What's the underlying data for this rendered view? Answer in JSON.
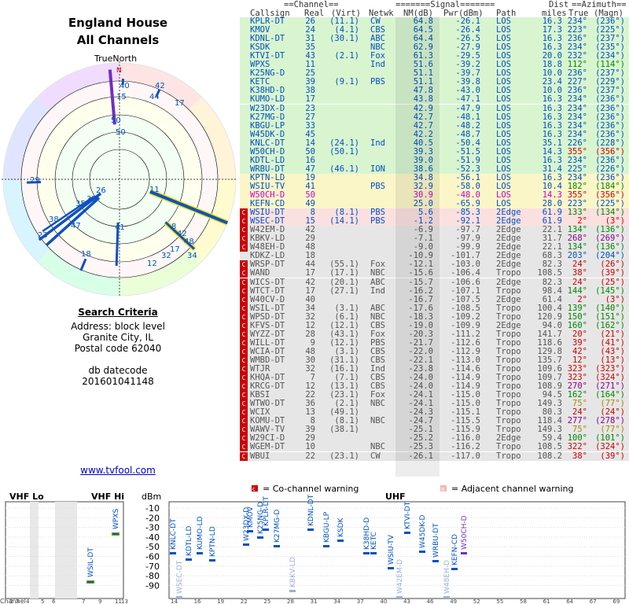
{
  "header": {
    "title": "England House",
    "subtitle": "All Channels",
    "north_label": "TrueNorth",
    "north_mark": "N"
  },
  "search": {
    "heading": "Search Criteria",
    "address": "Address: block level",
    "city": "Granite City, IL",
    "postal": "Postal code 62040",
    "db_label": "db datecode",
    "db_value": "201601041148"
  },
  "footer_link": "www.tvfool.com",
  "table_headers": {
    "group_channel": "==Channel==",
    "group_signal": "=======Signal=======",
    "group_dist": "Dist",
    "group_azimuth": "==Azimuth==",
    "callsign": "Callsign",
    "real": "Real",
    "virt": "(Virt)",
    "netwk": "Netwk",
    "nm": "NM(dB)",
    "pwr": "Pwr(dBm)",
    "path": "Path",
    "miles": "miles",
    "true": "True",
    "magn": "(Magn)"
  },
  "stations": [
    {
      "call": "KPLR-DT",
      "real": "26",
      "virt": "(11.1)",
      "net": "CW",
      "nm": "64.8",
      "pwr": "-26.1",
      "path": "LOS",
      "dist": "16.3",
      "az": "234°",
      "mag": "(236°)",
      "band": "g",
      "w": ""
    },
    {
      "call": "KMOV",
      "real": "24",
      "virt": "(4.1)",
      "net": "CBS",
      "nm": "64.5",
      "pwr": "-26.4",
      "path": "LOS",
      "dist": "17.3",
      "az": "223°",
      "mag": "(225°)",
      "band": "g",
      "w": ""
    },
    {
      "call": "KDNL-DT",
      "real": "31",
      "virt": "(30.1)",
      "net": "ABC",
      "nm": "64.4",
      "pwr": "-26.5",
      "path": "LOS",
      "dist": "16.3",
      "az": "236°",
      "mag": "(237°)",
      "band": "g",
      "w": ""
    },
    {
      "call": "KSDK",
      "real": "35",
      "virt": "",
      "net": "NBC",
      "nm": "62.9",
      "pwr": "-27.9",
      "path": "LOS",
      "dist": "16.3",
      "az": "234°",
      "mag": "(235°)",
      "band": "g",
      "w": ""
    },
    {
      "call": "KTVI-DT",
      "real": "43",
      "virt": "(2.1)",
      "net": "Fox",
      "nm": "61.3",
      "pwr": "-29.5",
      "path": "LOS",
      "dist": "20.0",
      "az": "232°",
      "mag": "(234°)",
      "band": "g",
      "w": ""
    },
    {
      "call": "WPXS",
      "real": "11",
      "virt": "",
      "net": "Ind",
      "nm": "51.6",
      "pwr": "-39.2",
      "path": "LOS",
      "dist": "18.8",
      "az": "112°",
      "mag": "(114°)",
      "band": "g",
      "w": ""
    },
    {
      "call": "K25NG-D",
      "real": "25",
      "virt": "",
      "net": "",
      "nm": "51.1",
      "pwr": "-39.7",
      "path": "LOS",
      "dist": "10.0",
      "az": "236°",
      "mag": "(237°)",
      "band": "g",
      "w": ""
    },
    {
      "call": "KETC",
      "real": "39",
      "virt": "(9.1)",
      "net": "PBS",
      "nm": "51.1",
      "pwr": "-39.8",
      "path": "LOS",
      "dist": "23.4",
      "az": "227°",
      "mag": "(229°)",
      "band": "g",
      "w": ""
    },
    {
      "call": "K38HD-D",
      "real": "38",
      "virt": "",
      "net": "",
      "nm": "47.8",
      "pwr": "-43.0",
      "path": "LOS",
      "dist": "10.0",
      "az": "236°",
      "mag": "(237°)",
      "band": "g",
      "w": ""
    },
    {
      "call": "KUMO-LD",
      "real": "17",
      "virt": "",
      "net": "",
      "nm": "43.8",
      "pwr": "-47.1",
      "path": "LOS",
      "dist": "16.3",
      "az": "234°",
      "mag": "(236°)",
      "band": "g",
      "w": ""
    },
    {
      "call": "W23DX-D",
      "real": "23",
      "virt": "",
      "net": "",
      "nm": "42.9",
      "pwr": "-47.9",
      "path": "LOS",
      "dist": "16.3",
      "az": "234°",
      "mag": "(236°)",
      "band": "g",
      "w": ""
    },
    {
      "call": "K27MG-D",
      "real": "27",
      "virt": "",
      "net": "",
      "nm": "42.7",
      "pwr": "-48.1",
      "path": "LOS",
      "dist": "16.3",
      "az": "234°",
      "mag": "(236°)",
      "band": "g",
      "w": ""
    },
    {
      "call": "KBGU-LP",
      "real": "33",
      "virt": "",
      "net": "",
      "nm": "42.7",
      "pwr": "-48.2",
      "path": "LOS",
      "dist": "16.3",
      "az": "234°",
      "mag": "(236°)",
      "band": "g",
      "w": ""
    },
    {
      "call": "W45DK-D",
      "real": "45",
      "virt": "",
      "net": "",
      "nm": "42.2",
      "pwr": "-48.7",
      "path": "LOS",
      "dist": "16.3",
      "az": "234°",
      "mag": "(236°)",
      "band": "g",
      "w": ""
    },
    {
      "call": "KNLC-DT",
      "real": "14",
      "virt": "(24.1)",
      "net": "Ind",
      "nm": "40.5",
      "pwr": "-50.4",
      "path": "LOS",
      "dist": "35.1",
      "az": "226°",
      "mag": "(228°)",
      "band": "g",
      "w": ""
    },
    {
      "call": "W50CH-D",
      "real": "50",
      "virt": "(50.1)",
      "net": "",
      "nm": "39.3",
      "pwr": "-51.5",
      "path": "LOS",
      "dist": "14.3",
      "az": "355°",
      "mag": "(356°)",
      "band": "g",
      "w": ""
    },
    {
      "call": "KDTL-LD",
      "real": "16",
      "virt": "",
      "net": "",
      "nm": "39.0",
      "pwr": "-51.9",
      "path": "LOS",
      "dist": "16.3",
      "az": "234°",
      "mag": "(236°)",
      "band": "g",
      "w": ""
    },
    {
      "call": "WRBU-DT",
      "real": "47",
      "virt": "(46.1)",
      "net": "ION",
      "nm": "38.6",
      "pwr": "-52.3",
      "path": "LOS",
      "dist": "31.4",
      "az": "225°",
      "mag": "(226°)",
      "band": "g",
      "w": ""
    },
    {
      "call": "KPTN-LD",
      "real": "19",
      "virt": "",
      "net": "",
      "nm": "34.8",
      "pwr": "-56.1",
      "path": "LOS",
      "dist": "16.3",
      "az": "234°",
      "mag": "(236°)",
      "band": "y",
      "w": ""
    },
    {
      "call": "WSIU-TV",
      "real": "41",
      "virt": "",
      "net": "PBS",
      "nm": "32.9",
      "pwr": "-58.0",
      "path": "LOS",
      "dist": "10.4",
      "az": "182°",
      "mag": "(184°)",
      "band": "y",
      "w": ""
    },
    {
      "call": "W50CH-D",
      "real": "50",
      "virt": "",
      "net": "",
      "nm": "30.9",
      "pwr": "-48.0",
      "path": "LOS",
      "dist": "14.3",
      "az": "355°",
      "mag": "(356°)",
      "band": "p",
      "w": ""
    },
    {
      "call": "KEFN-CD",
      "real": "49",
      "virt": "",
      "net": "",
      "nm": "25.0",
      "pwr": "-65.9",
      "path": "LOS",
      "dist": "28.0",
      "az": "223°",
      "mag": "(225°)",
      "band": "y",
      "w": ""
    },
    {
      "call": "WSIU-DT",
      "real": "8",
      "virt": "(8.1)",
      "net": "PBS",
      "nm": "5.6",
      "pwr": "-85.3",
      "path": "2Edge",
      "dist": "61.9",
      "az": "133°",
      "mag": "(134°)",
      "band": "r",
      "w": "C"
    },
    {
      "call": "WSEC-DT",
      "real": "15",
      "virt": "(14.1)",
      "net": "PBS",
      "nm": "-1.2",
      "pwr": "-92.1",
      "path": "2Edge",
      "dist": "61.9",
      "az": "2°",
      "mag": "(3°)",
      "band": "r",
      "w": "C"
    },
    {
      "call": "W42EM-D",
      "real": "42",
      "virt": "",
      "net": "",
      "nm": "-6.9",
      "pwr": "-97.7",
      "path": "2Edge",
      "dist": "22.1",
      "az": "134°",
      "mag": "(136°)",
      "band": "x",
      "w": "C"
    },
    {
      "call": "KBKV-LD",
      "real": "29",
      "virt": "",
      "net": "",
      "nm": "-7.1",
      "pwr": "-97.9",
      "path": "2Edge",
      "dist": "31.7",
      "az": "268°",
      "mag": "(269°)",
      "band": "x",
      "w": "C"
    },
    {
      "call": "W48EH-D",
      "real": "48",
      "virt": "",
      "net": "",
      "nm": "-9.0",
      "pwr": "-99.9",
      "path": "2Edge",
      "dist": "22.1",
      "az": "134°",
      "mag": "(136°)",
      "band": "x",
      "w": "C"
    },
    {
      "call": "KDKZ-LD",
      "real": "18",
      "virt": "",
      "net": "",
      "nm": "-10.9",
      "pwr": "-101.7",
      "path": "2Edge",
      "dist": "68.3",
      "az": "203°",
      "mag": "(204°)",
      "band": "x",
      "w": ""
    },
    {
      "call": "WRSP-DT",
      "real": "44",
      "virt": "(55.1)",
      "net": "Fox",
      "nm": "-12.1",
      "pwr": "-103.0",
      "path": "2Edge",
      "dist": "82.3",
      "az": "24°",
      "mag": "(26°)",
      "band": "x",
      "w": "C"
    },
    {
      "call": "WAND",
      "real": "17",
      "virt": "(17.1)",
      "net": "NBC",
      "nm": "-15.6",
      "pwr": "-106.4",
      "path": "Tropo",
      "dist": "108.5",
      "az": "38°",
      "mag": "(39°)",
      "band": "x",
      "w": "C"
    },
    {
      "call": "WICS-DT",
      "real": "42",
      "virt": "(20.1)",
      "net": "ABC",
      "nm": "-15.7",
      "pwr": "-106.6",
      "path": "2Edge",
      "dist": "82.3",
      "az": "24°",
      "mag": "(25°)",
      "band": "x",
      "w": "C"
    },
    {
      "call": "WTCT-DT",
      "real": "17",
      "virt": "(27.1)",
      "net": "Ind",
      "nm": "-16.2",
      "pwr": "-107.1",
      "path": "Tropo",
      "dist": "98.4",
      "az": "144°",
      "mag": "(145°)",
      "band": "x",
      "w": "C"
    },
    {
      "call": "W40CV-D",
      "real": "40",
      "virt": "",
      "net": "",
      "nm": "-16.7",
      "pwr": "-107.5",
      "path": "2Edge",
      "dist": "61.4",
      "az": "2°",
      "mag": "(3°)",
      "band": "x",
      "w": "C"
    },
    {
      "call": "WSIL-DT",
      "real": "34",
      "virt": "(3.1)",
      "net": "ABC",
      "nm": "-17.6",
      "pwr": "-108.5",
      "path": "Tropo",
      "dist": "100.4",
      "az": "139°",
      "mag": "(140°)",
      "band": "x",
      "w": "C"
    },
    {
      "call": "WPSD-DT",
      "real": "32",
      "virt": "(6.1)",
      "net": "NBC",
      "nm": "-18.3",
      "pwr": "-109.2",
      "path": "Tropo",
      "dist": "120.9",
      "az": "150°",
      "mag": "(151°)",
      "band": "x",
      "w": "C"
    },
    {
      "call": "KFVS-DT",
      "real": "12",
      "virt": "(12.1)",
      "net": "CBS",
      "nm": "-19.0",
      "pwr": "-109.9",
      "path": "2Edge",
      "dist": "94.0",
      "az": "160°",
      "mag": "(162°)",
      "band": "x",
      "w": "C"
    },
    {
      "call": "WYZZ-DT",
      "real": "28",
      "virt": "(43.1)",
      "net": "Fox",
      "nm": "-20.3",
      "pwr": "-111.2",
      "path": "Tropo",
      "dist": "141.7",
      "az": "20°",
      "mag": "(21°)",
      "band": "x",
      "w": "C"
    },
    {
      "call": "WILL-DT",
      "real": "9",
      "virt": "(12.1)",
      "net": "PBS",
      "nm": "-21.7",
      "pwr": "-112.6",
      "path": "Tropo",
      "dist": "118.6",
      "az": "39°",
      "mag": "(41°)",
      "band": "x",
      "w": "C"
    },
    {
      "call": "WCIA-DT",
      "real": "48",
      "virt": "(3.1)",
      "net": "CBS",
      "nm": "-22.0",
      "pwr": "-112.9",
      "path": "Tropo",
      "dist": "129.8",
      "az": "42°",
      "mag": "(43°)",
      "band": "x",
      "w": "C"
    },
    {
      "call": "WMBD-DT",
      "real": "30",
      "virt": "(31.1)",
      "net": "CBS",
      "nm": "-22.1",
      "pwr": "-113.0",
      "path": "Tropo",
      "dist": "135.7",
      "az": "12°",
      "mag": "(13°)",
      "band": "x",
      "w": "C"
    },
    {
      "call": "WTJR",
      "real": "32",
      "virt": "(16.1)",
      "net": "Ind",
      "nm": "-23.8",
      "pwr": "-114.6",
      "path": "Tropo",
      "dist": "109.6",
      "az": "323°",
      "mag": "(323°)",
      "band": "x",
      "w": "C"
    },
    {
      "call": "KHQA-DT",
      "real": "7",
      "virt": "(7.1)",
      "net": "CBS",
      "nm": "-24.0",
      "pwr": "-114.9",
      "path": "Tropo",
      "dist": "109.7",
      "az": "323°",
      "mag": "(324°)",
      "band": "x",
      "w": "C"
    },
    {
      "call": "KRCG-DT",
      "real": "12",
      "virt": "(13.1)",
      "net": "CBS",
      "nm": "-24.0",
      "pwr": "-114.9",
      "path": "Tropo",
      "dist": "108.9",
      "az": "270°",
      "mag": "(271°)",
      "band": "x",
      "w": "C"
    },
    {
      "call": "KBSI",
      "real": "22",
      "virt": "(23.1)",
      "net": "Fox",
      "nm": "-24.1",
      "pwr": "-115.0",
      "path": "Tropo",
      "dist": "94.5",
      "az": "162°",
      "mag": "(164°)",
      "band": "x",
      "w": "C"
    },
    {
      "call": "WTWO-DT",
      "real": "36",
      "virt": "(2.1)",
      "net": "NBC",
      "nm": "-24.1",
      "pwr": "-115.0",
      "path": "Tropo",
      "dist": "149.3",
      "az": "75°",
      "mag": "(77°)",
      "band": "x",
      "w": "C"
    },
    {
      "call": "WCIX",
      "real": "13",
      "virt": "(49.1)",
      "net": "",
      "nm": "-24.3",
      "pwr": "-115.1",
      "path": "Tropo",
      "dist": "80.3",
      "az": "24°",
      "mag": "(24°)",
      "band": "x",
      "w": "C"
    },
    {
      "call": "KOMU-DT",
      "real": "8",
      "virt": "(8.1)",
      "net": "NBC",
      "nm": "-24.7",
      "pwr": "-115.5",
      "path": "Tropo",
      "dist": "118.4",
      "az": "277°",
      "mag": "(278°)",
      "band": "x",
      "w": "C"
    },
    {
      "call": "WAWV-TV",
      "real": "39",
      "virt": "(38.1)",
      "net": "",
      "nm": "-25.1",
      "pwr": "-115.9",
      "path": "Tropo",
      "dist": "149.3",
      "az": "75°",
      "mag": "(77°)",
      "band": "x",
      "w": "C"
    },
    {
      "call": "W29CI-D",
      "real": "29",
      "virt": "",
      "net": "",
      "nm": "-25.2",
      "pwr": "-116.0",
      "path": "2Edge",
      "dist": "59.4",
      "az": "100°",
      "mag": "(101°)",
      "band": "x",
      "w": "C"
    },
    {
      "call": "WGEM-DT",
      "real": "10",
      "virt": "",
      "net": "NBC",
      "nm": "-25.3",
      "pwr": "-116.2",
      "path": "Tropo",
      "dist": "108.5",
      "az": "322°",
      "mag": "(324°)",
      "band": "x",
      "w": "C"
    },
    {
      "call": "WBUI",
      "real": "22",
      "virt": "(23.1)",
      "net": "CW",
      "nm": "-26.1",
      "pwr": "-117.0",
      "path": "Tropo",
      "dist": "108.2",
      "az": "38°",
      "mag": "(39°)",
      "band": "x",
      "w": "C"
    }
  ],
  "polar_labels": [
    {
      "t": "40"
    },
    {
      "t": "15"
    },
    {
      "t": "42"
    },
    {
      "t": "44"
    },
    {
      "t": "17"
    },
    {
      "t": "50"
    },
    {
      "t": "50"
    },
    {
      "t": "29"
    },
    {
      "t": "11"
    },
    {
      "t": "26"
    },
    {
      "t": "41"
    },
    {
      "t": "8"
    },
    {
      "t": "42"
    },
    {
      "t": "48"
    },
    {
      "t": "18"
    },
    {
      "t": "17"
    },
    {
      "t": "32"
    },
    {
      "t": "34"
    },
    {
      "t": "12"
    },
    {
      "t": "23"
    },
    {
      "t": "38"
    },
    {
      "t": "35"
    },
    {
      "t": "33"
    },
    {
      "t": "47"
    }
  ],
  "bottom": {
    "vhf_lo": "VHF Lo",
    "vhf_hi": "VHF Hi",
    "uhf": "UHF",
    "dbm_label": "dBm",
    "channel_label": "Channel",
    "co_legend": "= Co-channel warning",
    "adj_legend": "= Adjacent channel warning",
    "co_mark": "c",
    "adj_mark": "a",
    "dbm_ticks": [
      "-10",
      "-20",
      "-30",
      "-40",
      "-50",
      "-60",
      "-70",
      "-80",
      "-90"
    ],
    "vhf_ch_ticks": [
      "2",
      "3",
      "4",
      "5",
      "6",
      "7",
      "9",
      "11",
      "13"
    ],
    "uhf_ch_ticks": [
      "14",
      "16",
      "19",
      "22",
      "25",
      "28",
      "31",
      "34",
      "37",
      "40",
      "43",
      "46",
      "49",
      "52",
      "55",
      "58",
      "61",
      "64",
      "67",
      "69"
    ],
    "uhf_labels": [
      "KNLC-DT",
      "KDTL-LD",
      "KUMO-LD",
      "KPTN-LD",
      "W23DX-D",
      "KMOV",
      "K25NG-D",
      "KPLR-DT",
      "K27MG-D",
      "KBKV-LD",
      "KDNL-DT",
      "KBGU-LP",
      "KSDK",
      "K38HD-D",
      "KETC",
      "WSIU-TV",
      "W42EM-D",
      "KTVI-DT",
      "W45DK-D",
      "WRBU-DT",
      "W48EH-D",
      "KEFN-CD",
      "W50CH-D",
      "WSEC-DT"
    ],
    "vhf_labels": [
      "WSIL-DT",
      "WPXS"
    ]
  }
}
